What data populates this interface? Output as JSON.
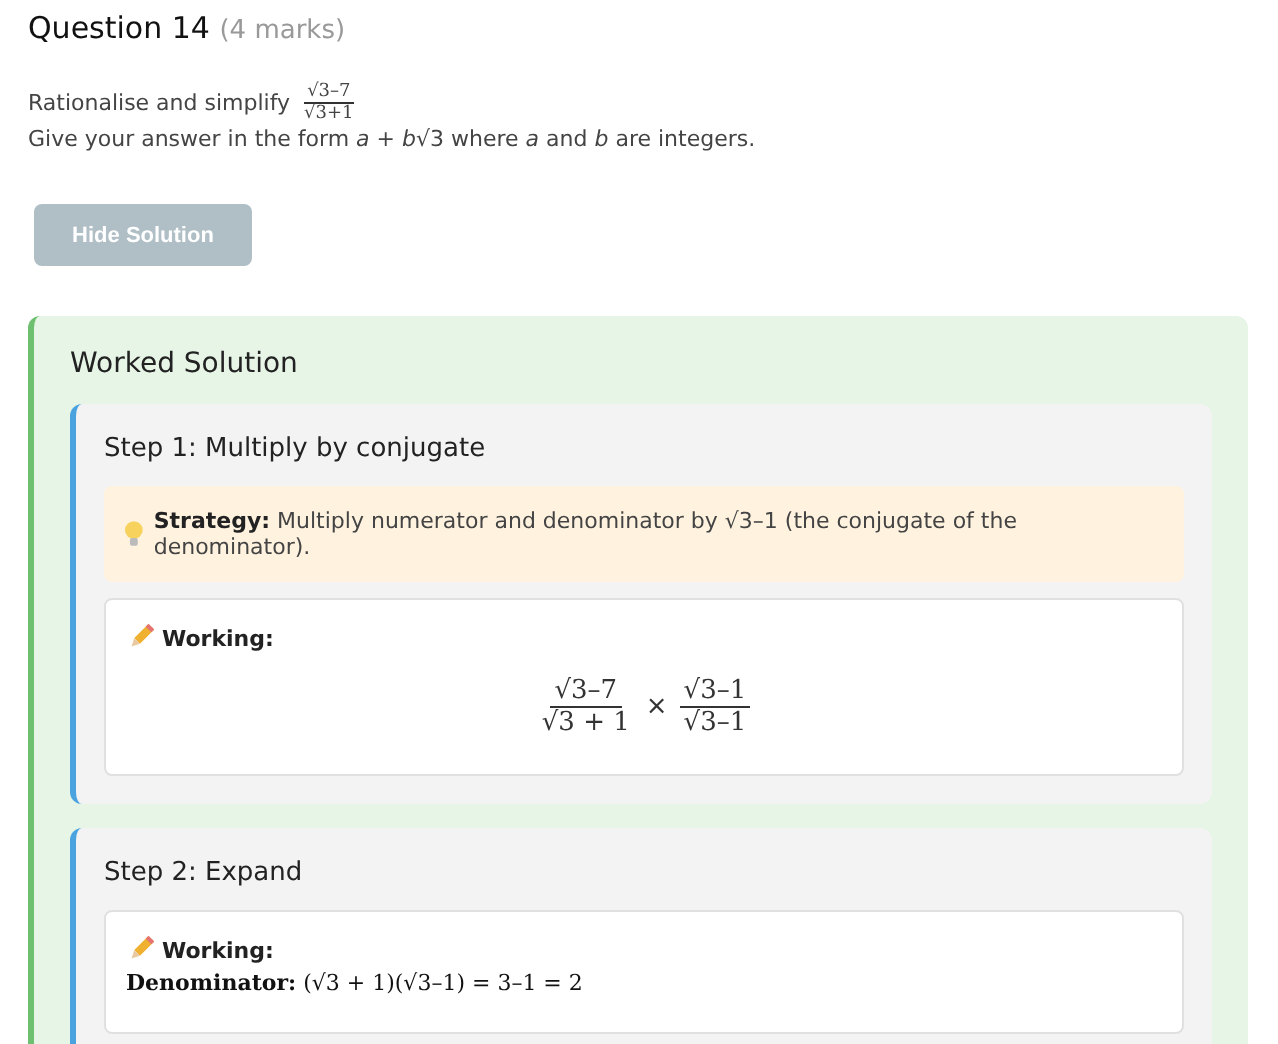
{
  "question": {
    "title": "Question 14",
    "marks": "(4 marks)"
  },
  "prompt": {
    "text": "Rationalise and simplify",
    "fraction": {
      "numerator": "√3–7",
      "denominator": "√3+1"
    }
  },
  "instruction": "Give your answer in the form *a* + *b*√3 where *a* and *b* are integers.",
  "button": {
    "label": "Hide Solution"
  },
  "solution": {
    "title": "Worked Solution",
    "steps": [
      {
        "title": "Step 1: Multiply by conjugate",
        "strategy": {
          "label": "Strategy:",
          "text": "Multiply numerator and denominator by √3–1 (the conjugate of the denominator)."
        },
        "working": {
          "label": "Working:",
          "fractions": [
            {
              "numerator": "√3–7",
              "denominator": "√3 + 1"
            },
            {
              "numerator": "√3–1",
              "denominator": "√3–1"
            }
          ],
          "operator": "×"
        }
      },
      {
        "title": "Step 2: Expand",
        "working": {
          "label": "Working:",
          "lines": [
            {
              "label": "Denominator:",
              "text": "(√3 + 1)(√3–1) = 3–1 = 2"
            }
          ]
        }
      }
    ]
  }
}
